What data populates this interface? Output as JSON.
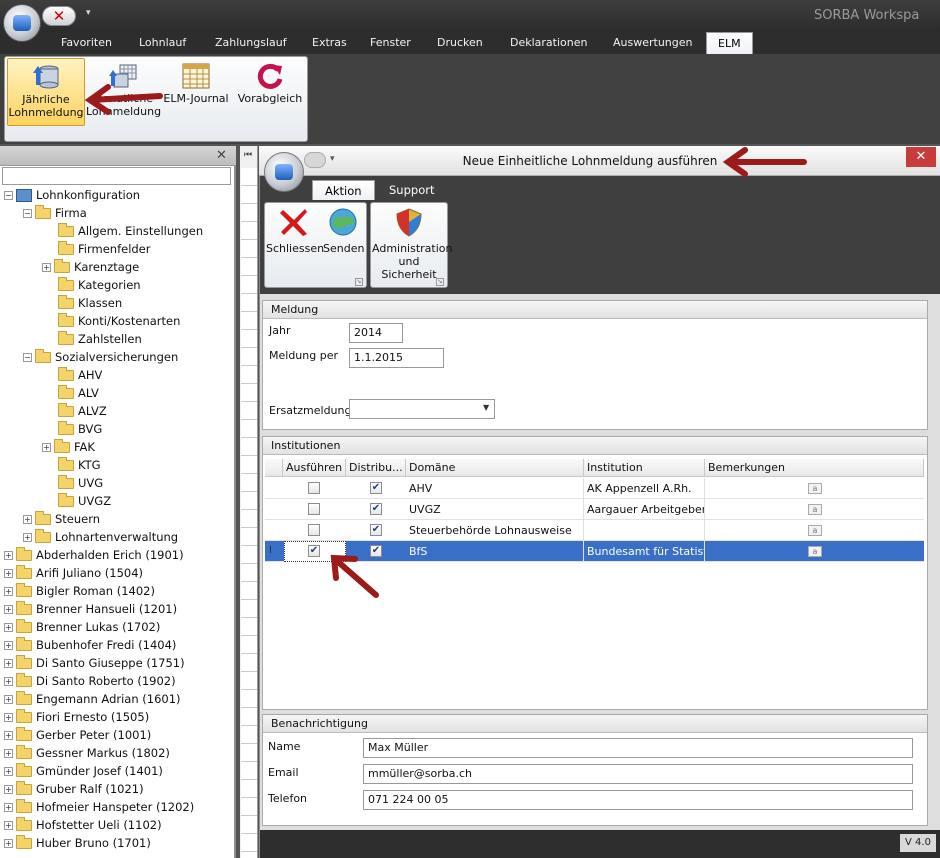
{
  "app": {
    "title": "SORBA Workspa"
  },
  "menu_tabs": [
    "Favoriten",
    "Lohnlauf",
    "Zahlungslauf",
    "Extras",
    "Fenster",
    "Drucken",
    "Deklarationen",
    "Auswertungen",
    "ELM"
  ],
  "ribbon": {
    "buttons": [
      {
        "label_line1": "Jährliche",
        "label_line2": "Lohnmeldung"
      },
      {
        "label_line1": "Monatliche",
        "label_line2": "Lohnmeldung"
      },
      {
        "label_line1": "ELM-Journal",
        "label_line2": ""
      },
      {
        "label_line1": "Vorabgleich",
        "label_line2": ""
      }
    ]
  },
  "tree": {
    "root": "Lohnkonfiguration",
    "firma": "Firma",
    "firma_items": [
      "Allgem. Einstellungen",
      "Firmenfelder",
      "Karenztage",
      "Kategorien",
      "Klassen",
      "Konti/Kostenarten",
      "Zahlstellen"
    ],
    "sozial": "Sozialversicherungen",
    "sozial_items": [
      "AHV",
      "ALV",
      "ALVZ",
      "BVG",
      "FAK",
      "KTG",
      "UVG",
      "UVGZ"
    ],
    "steuern": "Steuern",
    "lohnarten": "Lohnartenverwaltung",
    "employees": [
      "Abderhalden Erich (1901)",
      "Arifi Juliano (1504)",
      "Bigler Roman (1402)",
      "Brenner Hansueli (1201)",
      "Brenner Lukas (1702)",
      "Bubenhofer Fredi (1404)",
      "Di Santo Giuseppe (1751)",
      "Di Santo Roberto (1902)",
      "Engemann Adrian (1601)",
      "Fiori Ernesto (1505)",
      "Gerber Peter (1001)",
      "Gessner Markus (1802)",
      "Gmünder Josef (1401)",
      "Gruber Ralf (1021)",
      "Hofmeier Hanspeter (1202)",
      "Hofstetter Ueli (1102)",
      "Huber Bruno (1701)"
    ]
  },
  "dialog": {
    "title": "Neue Einheitliche Lohnmeldung ausführen",
    "tabs": [
      "Aktion",
      "Support"
    ],
    "buttons": {
      "close": "Schliessen",
      "send": "Senden",
      "admin_line1": "Administration",
      "admin_line2": "und Sicherheit"
    },
    "meldung": {
      "header": "Meldung",
      "jahr_label": "Jahr",
      "jahr_value": "2014",
      "per_label": "Meldung per",
      "per_value": "1.1.2015",
      "ersatz_label": "Ersatzmeldung",
      "ersatz_value": ""
    },
    "institutionen": {
      "header": "Institutionen",
      "columns": [
        "Ausführen",
        "Distribu...",
        "Domäne",
        "Institution",
        "Bemerkungen"
      ],
      "rows": [
        {
          "ausfuehren": false,
          "distribution": true,
          "domaene": "AHV",
          "institution": "AK Appenzell A.Rh."
        },
        {
          "ausfuehren": false,
          "distribution": true,
          "domaene": "UVGZ",
          "institution": "Aargauer Arbeitgeber"
        },
        {
          "ausfuehren": false,
          "distribution": true,
          "domaene": "Steuerbehörde Lohnausweise",
          "institution": ""
        },
        {
          "ausfuehren": true,
          "distribution": true,
          "domaene": "BfS",
          "institution": "Bundesamt für Statistik",
          "selected": true
        }
      ]
    },
    "benachrichtigung": {
      "header": "Benachrichtigung",
      "name_label": "Name",
      "name_value": "Max Müller",
      "email_label": "Email",
      "email_value": "mmüller@sorba.ch",
      "telefon_label": "Telefon",
      "telefon_value": "071 224 00 05"
    },
    "version": "V 4.0"
  },
  "colors": {
    "accent_selected": "#3a6fc7",
    "annotation_arrow": "#9b1b1b",
    "dialog_close": "#c73b3b"
  }
}
